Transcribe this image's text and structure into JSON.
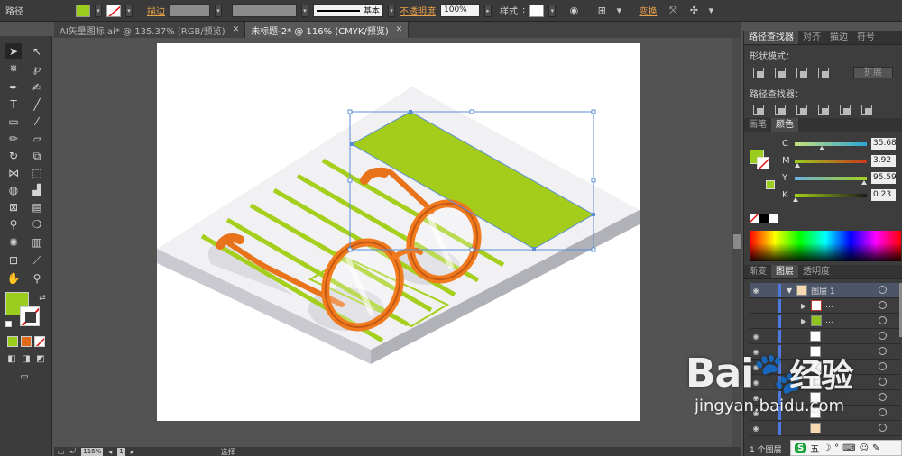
{
  "control_bar": {
    "object_type": "路径",
    "fill_color": "#9acd1e",
    "stroke_label": "描边",
    "stroke_profile": "基本",
    "opacity_label": "不透明度",
    "opacity_value": "100%",
    "style_label": "样式",
    "transform_label": "变换"
  },
  "doc_tabs": [
    {
      "label": "AI矢量图标.ai* @ 135.37% (RGB/预览)"
    },
    {
      "label": "未标题-2* @ 116% (CMYK/预览)"
    }
  ],
  "status_bar": {
    "zoom": "116%",
    "artboard": "1",
    "tool_name": "选择"
  },
  "panels": {
    "pathfinder_tabs": [
      "路径查找器",
      "对齐",
      "描边",
      "符号"
    ],
    "shape_modes_label": "形状模式：",
    "expand_label": "扩展",
    "pathfinders_label": "路径查找器：",
    "color_tabs": [
      "画笔",
      "颜色"
    ],
    "channels": [
      {
        "name": "C",
        "value": "35.68",
        "percent": 35.68
      },
      {
        "name": "M",
        "value": "3.92",
        "percent": 3.92
      },
      {
        "name": "Y",
        "value": "95.59",
        "percent": 95.59
      },
      {
        "name": "K",
        "value": "0.23",
        "percent": 0.23
      }
    ],
    "layers_tabs": [
      "渐变",
      "图层",
      "透明度"
    ],
    "layer_name": "图层 1",
    "sublayer_name": "...",
    "layer_count": "1 个图层"
  },
  "colors": {
    "accent_green": "#9acd1e",
    "glasses_orange": "#f07a1e",
    "selection_blue": "#5b8dd6"
  },
  "watermark": {
    "brand": "Bai",
    "brand_suffix": "经验",
    "url": "jingyan.baidu.com"
  }
}
